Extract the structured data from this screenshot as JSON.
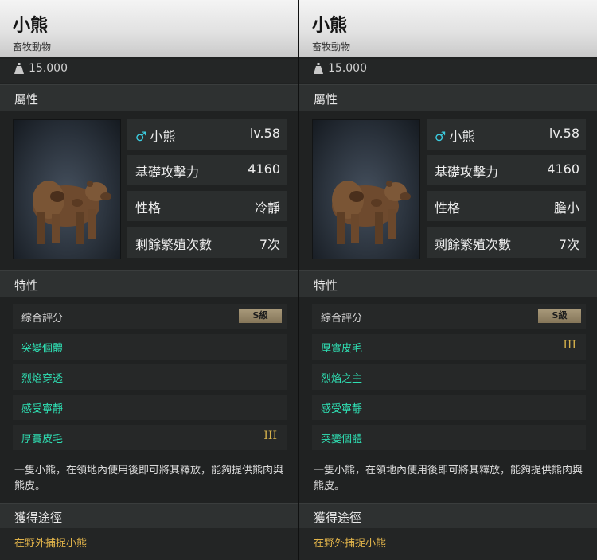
{
  "cards": [
    {
      "title": "小熊",
      "category": "畜牧動物",
      "weight": "15.000",
      "attributes_heading": "屬性",
      "stats": [
        {
          "label": "小熊",
          "value": "lv.58",
          "icon": "male-icon",
          "icon_color": "#3ccde0"
        },
        {
          "label": "基礎攻擊力",
          "value": "4160"
        },
        {
          "label": "性格",
          "value": "冷靜"
        },
        {
          "label": "剩餘繁殖次數",
          "value": "7次"
        }
      ],
      "traits_heading": "特性",
      "rating_label": "綜合評分",
      "rating_badge": "S級",
      "traits": [
        {
          "name": "突變個體",
          "tier": ""
        },
        {
          "name": "烈焰穿透",
          "tier": ""
        },
        {
          "name": "感受寧靜",
          "tier": ""
        },
        {
          "name": "厚實皮毛",
          "tier": "III"
        }
      ],
      "description": "一隻小熊，在領地內使用後即可將其釋放，能夠提供熊肉與熊皮。",
      "acquire_heading": "獲得途徑",
      "acquire_source": "在野外捕捉小熊"
    },
    {
      "title": "小熊",
      "category": "畜牧動物",
      "weight": "15.000",
      "attributes_heading": "屬性",
      "stats": [
        {
          "label": "小熊",
          "value": "lv.58",
          "icon": "male-icon",
          "icon_color": "#3ccde0"
        },
        {
          "label": "基礎攻擊力",
          "value": "4160"
        },
        {
          "label": "性格",
          "value": "膽小"
        },
        {
          "label": "剩餘繁殖次數",
          "value": "7次"
        }
      ],
      "traits_heading": "特性",
      "rating_label": "綜合評分",
      "rating_badge": "S級",
      "traits": [
        {
          "name": "厚實皮毛",
          "tier": "III"
        },
        {
          "name": "烈焰之主",
          "tier": ""
        },
        {
          "name": "感受寧靜",
          "tier": ""
        },
        {
          "name": "突變個體",
          "tier": ""
        }
      ],
      "description": "一隻小熊，在領地內使用後即可將其釋放，能夠提供熊肉與熊皮。",
      "acquire_heading": "獲得途徑",
      "acquire_source": "在野外捕捉小熊"
    }
  ],
  "colors": {
    "trait_text": "#2fe0b4",
    "tier_text": "#d7b24c",
    "source_text": "#e0b34a",
    "badge": "#a99a7b"
  }
}
